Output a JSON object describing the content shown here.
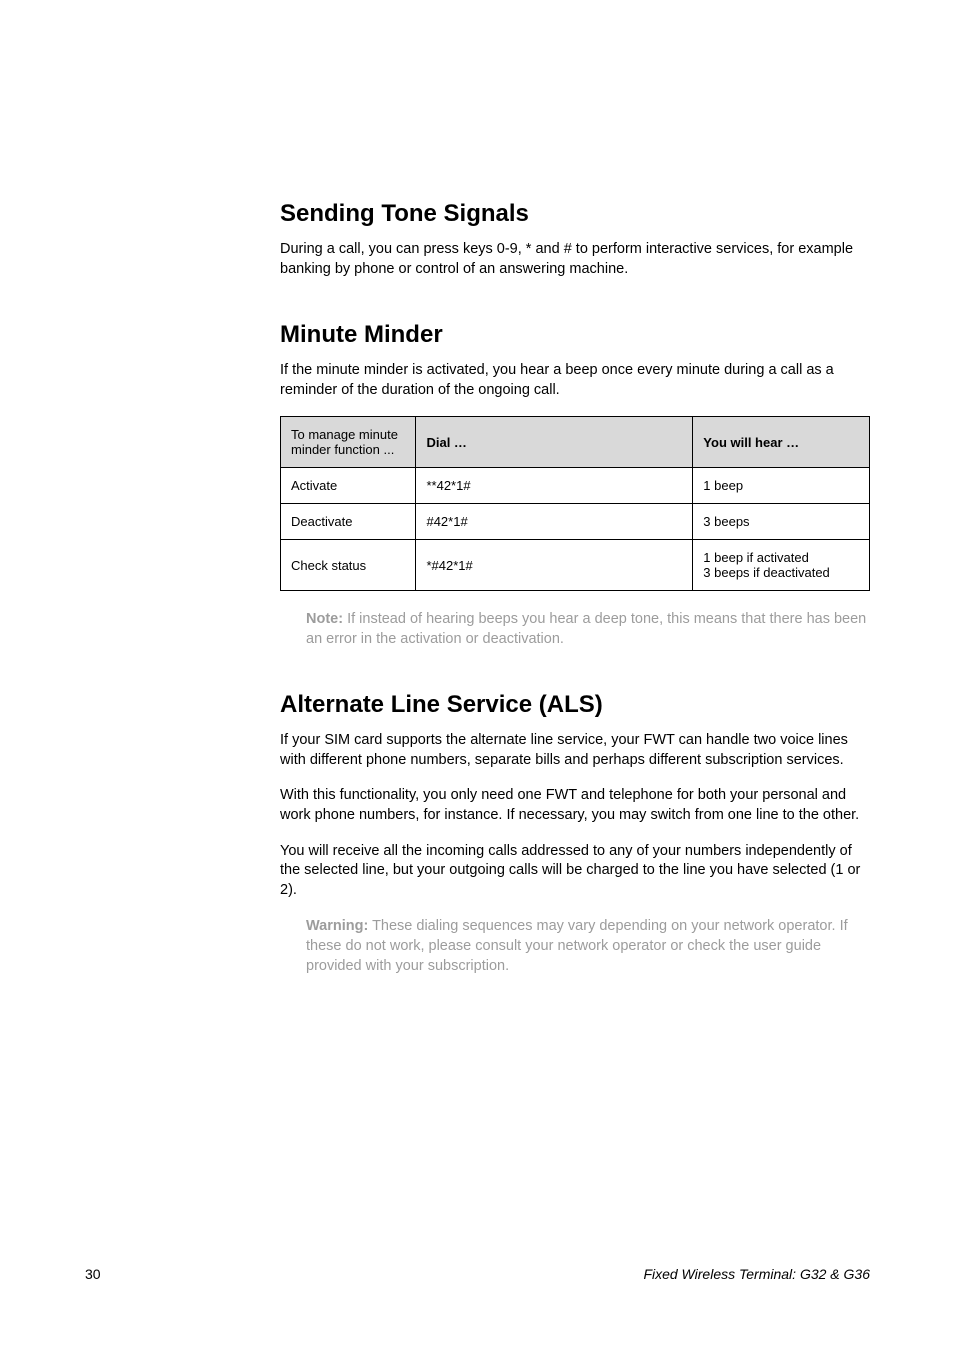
{
  "section1": {
    "heading": "Sending Tone Signals",
    "para": "During a call, you can press keys 0-9, * and # to perform interactive services, for example banking by phone or control of an answering machine."
  },
  "section2": {
    "heading": "Minute Minder",
    "para": "If the minute minder is activated, you hear a beep once every minute during a call as a reminder of the duration of the ongoing call.",
    "table": {
      "header": {
        "col1": "To manage minute minder function ...",
        "col2": "Dial …",
        "col3": "You will hear …"
      },
      "rows": [
        {
          "col1": "Activate",
          "col2": "**42*1#",
          "col3": "1 beep"
        },
        {
          "col1": "Deactivate",
          "col2": "#42*1#",
          "col3": "3 beeps"
        },
        {
          "col1": "Check status",
          "col2": "*#42*1#",
          "col3": "1 beep if activated\n3 beeps if deactivated"
        }
      ]
    },
    "note_label": "Note:",
    "note_text": " If instead of hearing beeps you hear a deep tone, this means that there has been an error in the activation or deactivation."
  },
  "section3": {
    "heading": "Alternate Line Service (ALS)",
    "para1": "If your SIM card supports the alternate line service, your FWT can handle two voice lines with different phone numbers, separate bills and perhaps different subscription services.",
    "para2": "With this functionality, you only need one FWT and telephone for both your personal and work phone numbers, for instance. If necessary, you may switch from one line to the other.",
    "para3": "You will receive all the incoming calls addressed to any of your numbers independently of the selected line, but your outgoing calls will be charged to the line you have selected (1 or 2).",
    "warning_label": "Warning:",
    "warning_text": " These dialing sequences may vary depending on your network operator. If these do not work, please consult your network operator or check the user guide provided with your subscription."
  },
  "footer": {
    "page": "30",
    "title": "Fixed Wireless Terminal: G32 & G36"
  }
}
